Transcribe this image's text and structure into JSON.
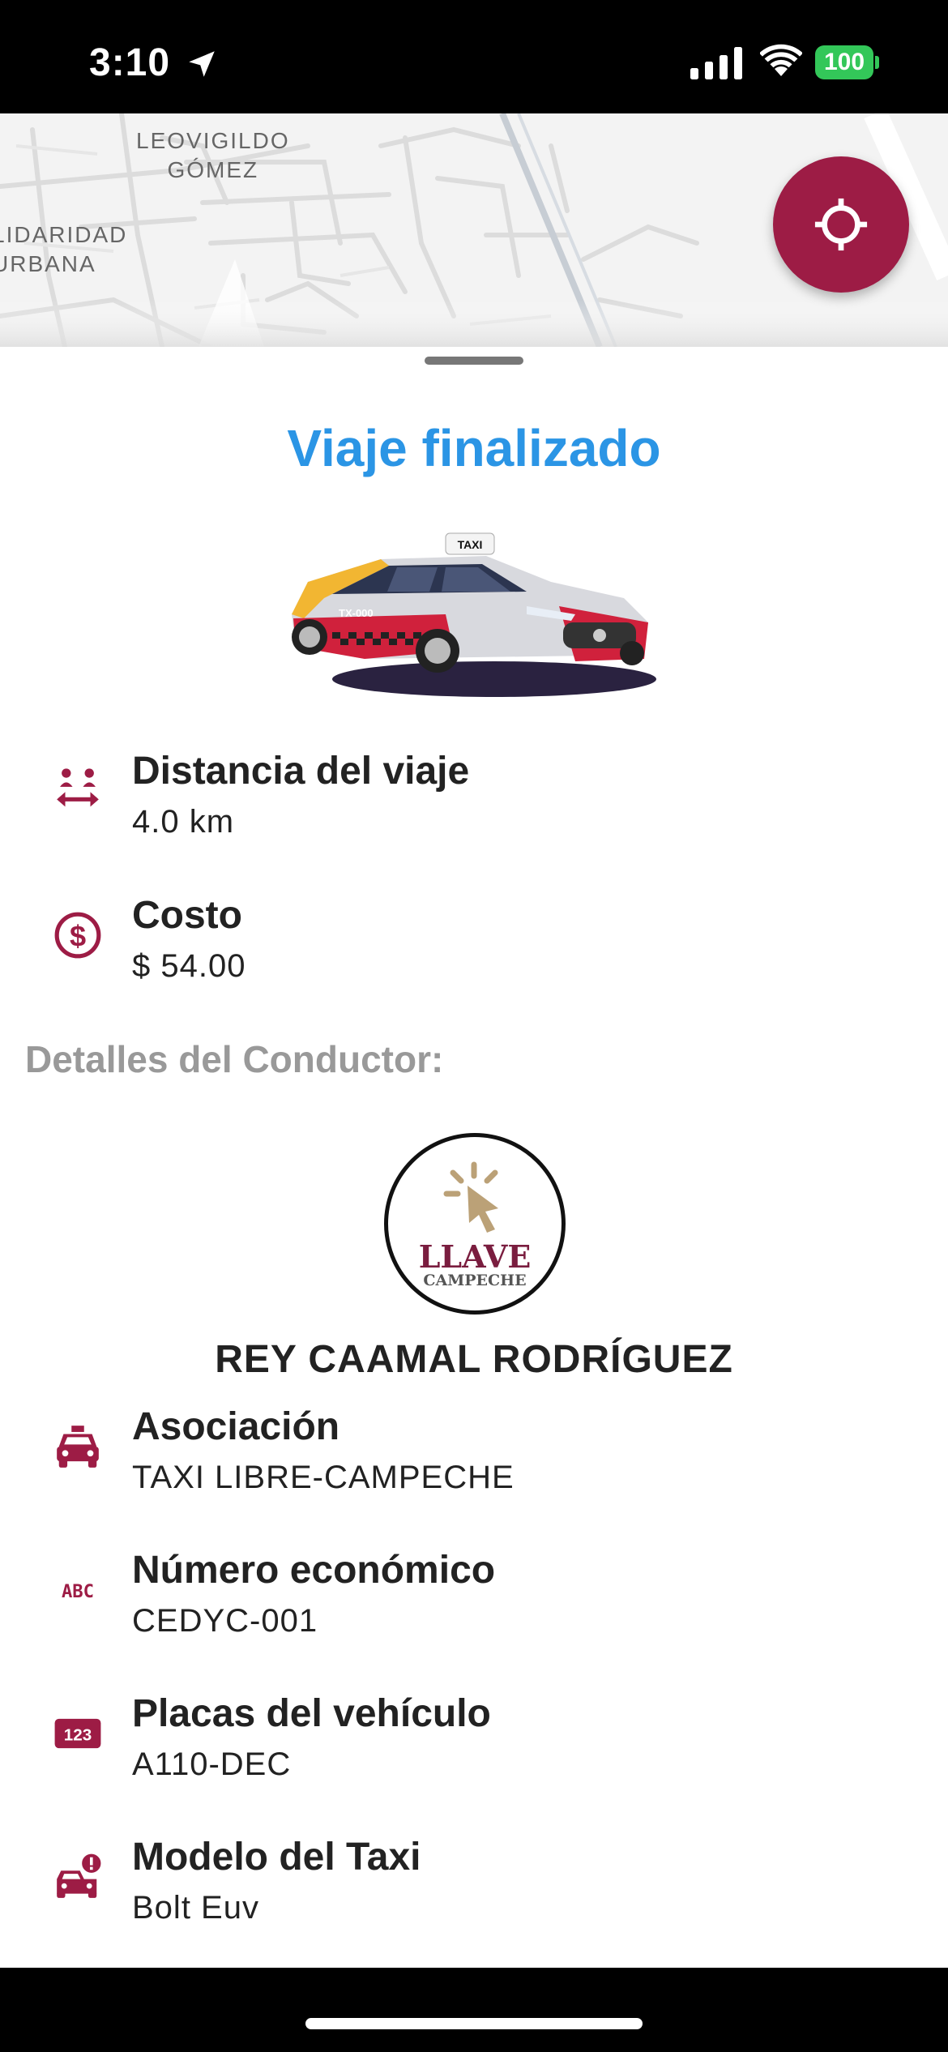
{
  "status_bar": {
    "time": "3:10",
    "battery": "100"
  },
  "map": {
    "labels": [
      {
        "text": "LEOVIGILDO\nGÓMEZ"
      },
      {
        "text": "LIDARIDAD\nURBANA"
      }
    ]
  },
  "trip": {
    "title": "Viaje finalizado",
    "distance_label": "Distancia del viaje",
    "distance_value": "4.0 km",
    "cost_label": "Costo",
    "cost_value": "$ 54.00"
  },
  "taxi_image": {
    "roof_sign": "TAXI",
    "door_text": "TX-000"
  },
  "driver": {
    "section_title": "Detalles del Conductor:",
    "logo": {
      "line1": "LLAVE",
      "line2": "CAMPECHE"
    },
    "name": "REY CAAMAL RODRÍGUEZ",
    "association_label": "Asociación",
    "association_value": "TAXI LIBRE-CAMPECHE",
    "economic_label": "Número económico",
    "economic_value": "CEDYC-001",
    "plates_label": "Placas del vehículo",
    "plates_value": "A110-DEC",
    "model_label": "Modelo del Taxi",
    "model_value": "Bolt Euv"
  },
  "icons": {
    "distance": "distance-icon",
    "cost": "dollar-circle-icon",
    "association": "taxi-icon",
    "economic": "abc-icon",
    "plates": "123-icon",
    "model": "car-alert-icon",
    "abc_text": "ABC",
    "num_text": "123"
  },
  "colors": {
    "accent": "#9d1c45",
    "title": "#2b95e5",
    "muted": "#999999",
    "battery": "#33c759"
  }
}
